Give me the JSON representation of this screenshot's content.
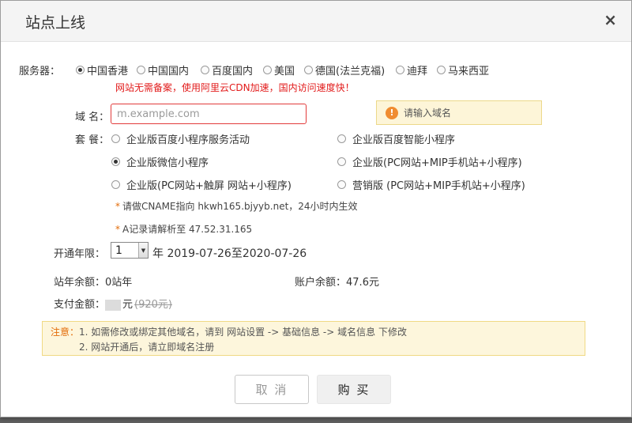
{
  "dialog": {
    "title": "站点上线",
    "close_symbol": "×"
  },
  "server": {
    "label": "服务器：",
    "options": [
      {
        "label": "中国香港",
        "checked": true
      },
      {
        "label": "中国国内",
        "checked": false
      },
      {
        "label": "百度国内",
        "checked": false
      },
      {
        "label": "美国",
        "checked": false
      },
      {
        "label": "德国(法兰克福)",
        "checked": false
      },
      {
        "label": "迪拜",
        "checked": false
      },
      {
        "label": "马来西亚",
        "checked": false
      }
    ],
    "note": "网站无需备案，使用阿里云CDN加速，国内访问速度快！"
  },
  "domain": {
    "label": "域 名：",
    "placeholder": "m.example.com",
    "value": "",
    "warning": "请输入域名",
    "warning_icon": "!"
  },
  "package": {
    "label": "套 餐：",
    "options": [
      {
        "label": "企业版百度小程序服务活动",
        "checked": false
      },
      {
        "label": "企业版百度智能小程序",
        "checked": false
      },
      {
        "label": "企业版微信小程序",
        "checked": true
      },
      {
        "label": "企业版(PC网站+MIP手机站+小程序)",
        "checked": false
      },
      {
        "label": "企业版(PC网站+触屏 网站+小程序)",
        "checked": false
      },
      {
        "label": "营销版 (PC网站+MIP手机站+小程序)",
        "checked": false
      }
    ]
  },
  "hints": {
    "star": "*",
    "cname": "请做CNAME指向 hkwh165.bjyyb.net，24小时内生效",
    "a_record": "A记录请解析至 47.52.31.165"
  },
  "term": {
    "label": "开通年限：",
    "selected": "1",
    "dropdown_icon": "▼",
    "unit": "年",
    "range": "2019-07-26至2020-07-26"
  },
  "balances": {
    "site_label": "站年余额：",
    "site_value": "0站年",
    "account_label": "账户余额：",
    "account_value": "47.6元"
  },
  "payment": {
    "label": "支付金额：",
    "currency": "元",
    "original_price": "(920元)"
  },
  "notice": {
    "label": "注意：",
    "line1": "1. 如需修改或绑定其他域名，请到 网站设置 -> 基础信息 -> 域名信息 下修改",
    "line2": "2. 网站开通后，请立即域名注册"
  },
  "buttons": {
    "cancel": "取 消",
    "buy": "购 买"
  }
}
